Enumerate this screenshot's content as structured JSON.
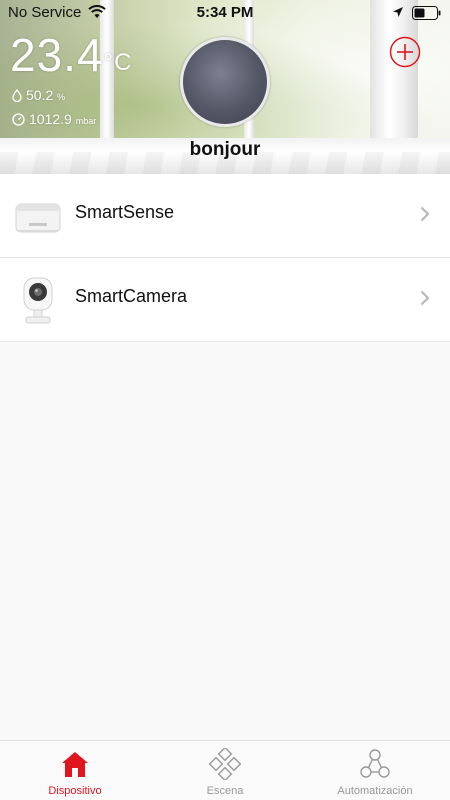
{
  "status_bar": {
    "carrier": "No Service",
    "time": "5:34 PM"
  },
  "weather": {
    "temperature": "23.4",
    "temperature_unit": "°C",
    "humidity": "50.2",
    "humidity_unit": "%",
    "pressure": "1012.9",
    "pressure_unit": "mbar"
  },
  "header": {
    "greeting": "bonjour",
    "add_icon": "plus-circle-icon"
  },
  "devices": [
    {
      "name": "SmartSense",
      "icon": "smartsense-device-icon"
    },
    {
      "name": "SmartCamera",
      "icon": "smartcamera-device-icon"
    }
  ],
  "tabs": [
    {
      "label": "Dispositivo",
      "icon": "house-icon",
      "active": true
    },
    {
      "label": "Escena",
      "icon": "scene-diamond-icon",
      "active": false
    },
    {
      "label": "Automatización",
      "icon": "automation-nodes-icon",
      "active": false
    }
  ],
  "colors": {
    "accent": "#e0161e",
    "inactive_tab": "#999999"
  }
}
